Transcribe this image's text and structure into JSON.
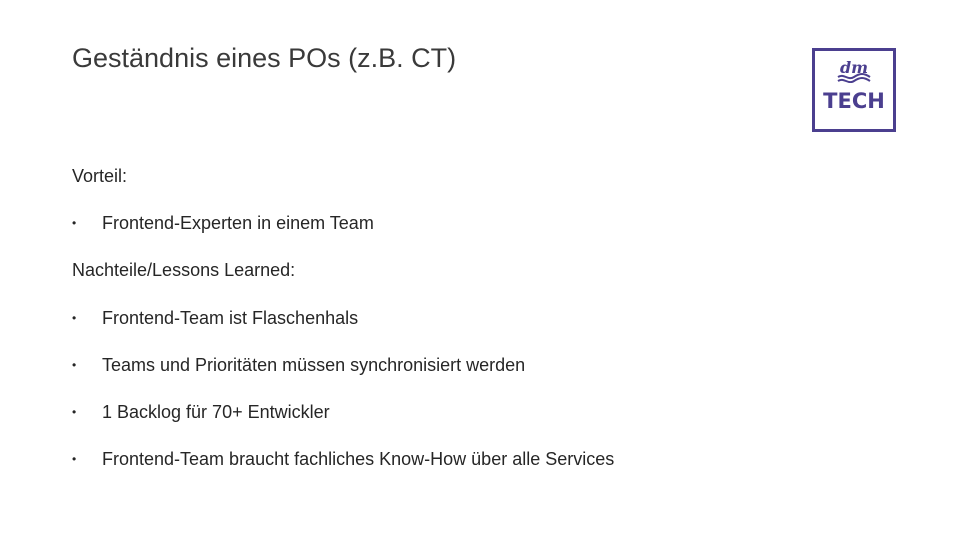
{
  "slide": {
    "title": "Geständnis eines POs (z.B. CT)",
    "logo": {
      "brand": "dm",
      "text": "TECH",
      "color": "#4b3f8f"
    },
    "lines": [
      {
        "type": "heading",
        "text": "Vorteil:"
      },
      {
        "type": "bullet",
        "bullet": "•",
        "text": "Frontend-Experten in einem Team"
      },
      {
        "type": "heading",
        "text": "Nachteile/Lessons Learned:"
      },
      {
        "type": "bullet",
        "bullet": "•",
        "text": "Frontend-Team ist Flaschenhals"
      },
      {
        "type": "bullet",
        "bullet": "•",
        "text": "Teams und Prioritäten müssen synchronisiert werden"
      },
      {
        "type": "bullet",
        "bullet": "•",
        "text": "1 Backlog für 70+ Entwickler"
      },
      {
        "type": "bullet",
        "bullet": "•",
        "text": "Frontend-Team braucht fachliches Know-How über alle Services"
      }
    ]
  }
}
